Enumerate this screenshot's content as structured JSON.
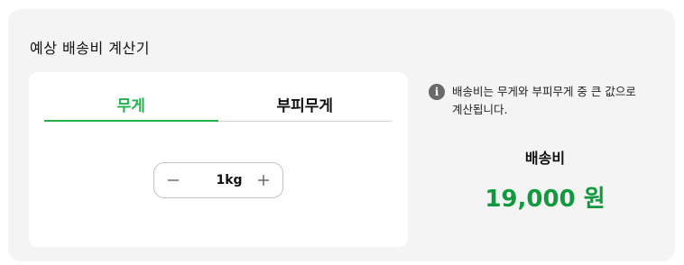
{
  "calculator": {
    "title": "예상 배송비 계산기",
    "tabs": [
      {
        "label": "무게",
        "active": true
      },
      {
        "label": "부피무게",
        "active": false
      }
    ],
    "stepper": {
      "value": "1kg",
      "decrement_icon": "minus-icon",
      "increment_icon": "plus-icon"
    },
    "info": {
      "icon": "info-icon",
      "icon_glyph": "i",
      "line1": "배송비는 무게와 부피무게 중 큰 값으로",
      "line2": "계산됩니다."
    },
    "fee": {
      "label": "배송비",
      "value": "19,000 원"
    },
    "colors": {
      "accent": "#22b14c",
      "fee_value": "#109a3d",
      "panel_bg": "#f4f4f4",
      "card_bg": "#ffffff"
    }
  }
}
